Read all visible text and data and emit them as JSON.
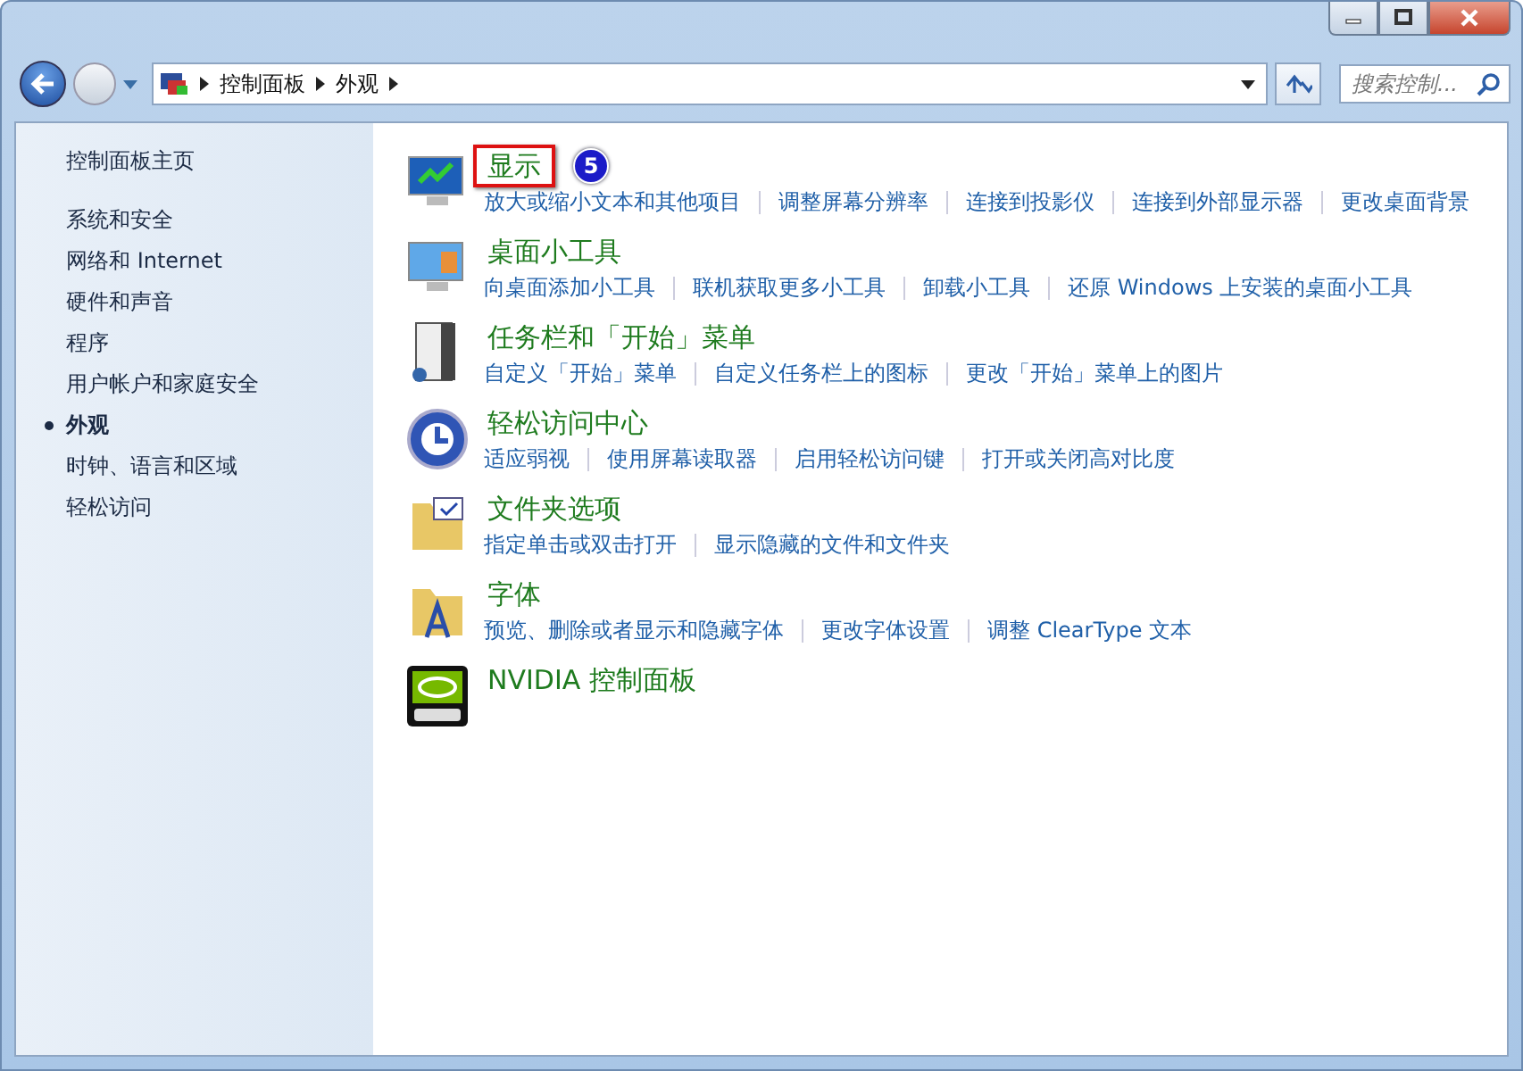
{
  "nav": {
    "breadcrumb": [
      "控制面板",
      "外观"
    ],
    "search": {
      "placeholder": "搜索控制..."
    }
  },
  "sidebar": {
    "home": "控制面板主页",
    "items": [
      {
        "label": "系统和安全",
        "selected": false
      },
      {
        "label": "网络和 Internet",
        "selected": false
      },
      {
        "label": "硬件和声音",
        "selected": false
      },
      {
        "label": "程序",
        "selected": false
      },
      {
        "label": "用户帐户和家庭安全",
        "selected": false
      },
      {
        "label": "外观",
        "selected": true
      },
      {
        "label": "时钟、语言和区域",
        "selected": false
      },
      {
        "label": "轻松访问",
        "selected": false
      }
    ]
  },
  "categories": [
    {
      "kind": "display",
      "title": "显示",
      "highlighted": true,
      "badge": "5",
      "links": [
        "放大或缩小文本和其他项目",
        "调整屏幕分辨率",
        "连接到投影仪",
        "连接到外部显示器",
        "更改桌面背景"
      ]
    },
    {
      "kind": "gadgets",
      "title": "桌面小工具",
      "highlighted": false,
      "links": [
        "向桌面添加小工具",
        "联机获取更多小工具",
        "卸载小工具",
        "还原 Windows 上安装的桌面小工具"
      ]
    },
    {
      "kind": "taskbar",
      "title": "任务栏和「开始」菜单",
      "highlighted": false,
      "links": [
        "自定义「开始」菜单",
        "自定义任务栏上的图标",
        "更改「开始」菜单上的图片"
      ]
    },
    {
      "kind": "access",
      "title": "轻松访问中心",
      "highlighted": false,
      "links": [
        "适应弱视",
        "使用屏幕读取器",
        "启用轻松访问键",
        "打开或关闭高对比度"
      ]
    },
    {
      "kind": "folder",
      "title": "文件夹选项",
      "highlighted": false,
      "links": [
        "指定单击或双击打开",
        "显示隐藏的文件和文件夹"
      ]
    },
    {
      "kind": "font",
      "title": "字体",
      "highlighted": false,
      "links": [
        "预览、删除或者显示和隐藏字体",
        "更改字体设置",
        "调整 ClearType 文本"
      ]
    },
    {
      "kind": "nvidia",
      "title": "NVIDIA 控制面板",
      "highlighted": false
    }
  ]
}
